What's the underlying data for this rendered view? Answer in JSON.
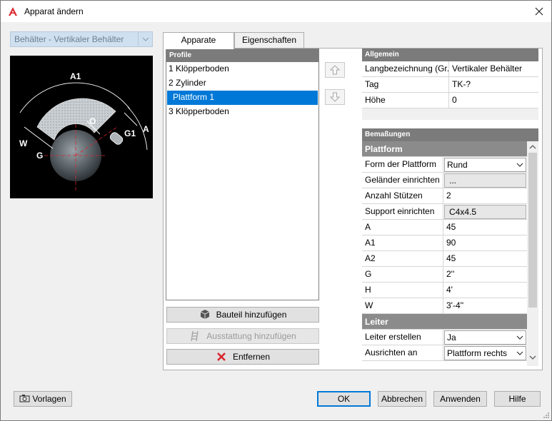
{
  "window": {
    "title": "Apparat ändern",
    "close_label": "✕"
  },
  "left": {
    "type_combo": "Behälter - Vertikaler Behälter",
    "preview_labels": {
      "A1": "A1",
      "O": "O",
      "G1": "G1",
      "A": "A",
      "W": "W",
      "G": "G"
    }
  },
  "tabs": [
    {
      "label": "Apparate",
      "active": true
    },
    {
      "label": "Eigenschaften",
      "active": false
    }
  ],
  "profile": {
    "header": "Profile",
    "items": [
      "1 Klöpperboden",
      "2 Zylinder",
      "Plattform 1",
      "3 Klöpperboden"
    ],
    "selected_index": 2
  },
  "actions": {
    "add_part": "Bauteil hinzufügen",
    "add_equipment": "Ausstattung hinzufügen",
    "remove": "Entfernen"
  },
  "general": {
    "header": "Allgemein",
    "rows": [
      {
        "name": "Langbezeichnung (Gr...",
        "value": "Vertikaler Behälter"
      },
      {
        "name": "Tag",
        "value": "TK-?"
      },
      {
        "name": "Höhe",
        "value": "0"
      }
    ]
  },
  "dimensions": {
    "header": "Bemaßungen",
    "category_platform": "Plattform",
    "platform_rows": [
      {
        "name": "Form der Plattform",
        "value": "Rund",
        "kind": "combo"
      },
      {
        "name": "Geländer einrichten",
        "value": "...",
        "kind": "button"
      },
      {
        "name": "Anzahl Stützen",
        "value": "2",
        "kind": "text"
      },
      {
        "name": "Support einrichten",
        "value": "C4x4.5",
        "kind": "button"
      },
      {
        "name": "A",
        "value": "45",
        "kind": "text"
      },
      {
        "name": "A1",
        "value": "90",
        "kind": "text"
      },
      {
        "name": "A2",
        "value": "45",
        "kind": "text"
      },
      {
        "name": "G",
        "value": "2''",
        "kind": "text"
      },
      {
        "name": "H",
        "value": "4'",
        "kind": "text"
      },
      {
        "name": "W",
        "value": "3'-4''",
        "kind": "text"
      }
    ],
    "category_ladder": "Leiter",
    "ladder_rows": [
      {
        "name": "Leiter erstellen",
        "value": "Ja",
        "kind": "combo"
      },
      {
        "name": "Ausrichten an",
        "value": "Plattform rechts",
        "kind": "combo"
      }
    ]
  },
  "footer": {
    "templates": "Vorlagen",
    "ok": "OK",
    "cancel": "Abbrechen",
    "apply": "Anwenden",
    "help": "Hilfe"
  },
  "colors": {
    "selection": "#0078d7",
    "header_bg": "#7b7b7b",
    "brand_red": "#d8262e"
  }
}
